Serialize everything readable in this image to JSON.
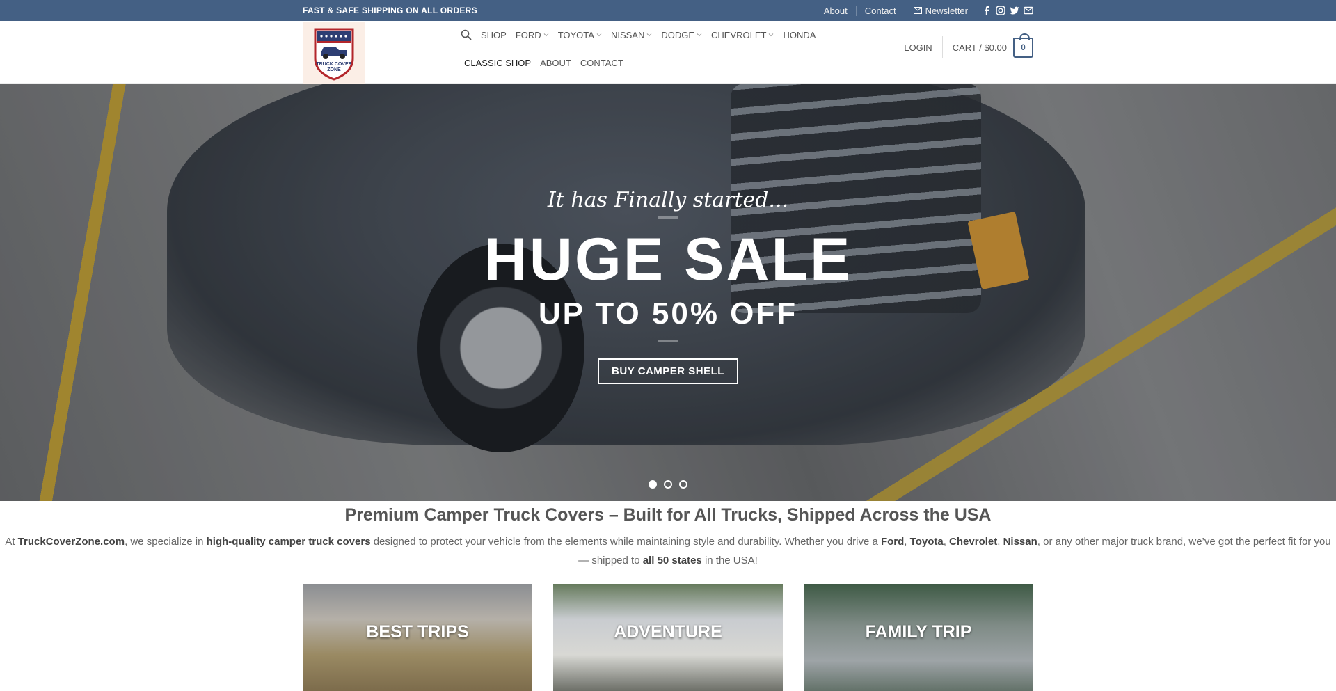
{
  "topbar": {
    "shipping_text": "FAST & SAFE SHIPPING ON ALL ORDERS",
    "links": [
      "About",
      "Contact",
      "Newsletter"
    ],
    "social_icons": [
      "facebook-icon",
      "instagram-icon",
      "twitter-icon",
      "email-icon"
    ]
  },
  "header": {
    "logo_text": "TRUCK COVER ZONE",
    "nav_row1": [
      {
        "label": "SHOP",
        "dropdown": false
      },
      {
        "label": "FORD",
        "dropdown": true
      },
      {
        "label": "TOYOTA",
        "dropdown": true
      },
      {
        "label": "NISSAN",
        "dropdown": true
      },
      {
        "label": "DODGE",
        "dropdown": true
      },
      {
        "label": "CHEVROLET",
        "dropdown": true
      },
      {
        "label": "HONDA",
        "dropdown": false
      }
    ],
    "nav_row2": [
      {
        "label": "CLASSIC SHOP",
        "active": true
      },
      {
        "label": "ABOUT",
        "active": false
      },
      {
        "label": "CONTACT",
        "active": false
      }
    ],
    "login": "LOGIN",
    "cart_label": "CART / $0.00",
    "cart_count": "0"
  },
  "hero": {
    "script": "It has Finally started...",
    "title": "HUGE SALE",
    "subtitle": "UP TO 50% OFF",
    "button": "BUY CAMPER SHELL",
    "slides": 3,
    "active_slide": 1
  },
  "intro": {
    "heading": "Premium Camper Truck Covers – Built for All Trucks, Shipped Across the USA",
    "p_at": "At ",
    "p_site": "TruckCoverZone.com",
    "p_spec": ", we specialize in ",
    "p_quality": "high-quality camper truck covers",
    "p_designed": " designed to protect your vehicle from the elements while maintaining style and durability. Whether you drive a ",
    "b_ford": "Ford",
    "b_toyota": "Toyota",
    "b_chevrolet": "Chevrolet",
    "b_nissan": "Nissan",
    "comma": ", ",
    "p_other": ", or any other major truck brand, we’ve got the perfect fit for you — shipped to ",
    "b_states": "all 50 states",
    "p_end": " in the USA!"
  },
  "cards": [
    {
      "label": "BEST TRIPS"
    },
    {
      "label": "ADVENTURE"
    },
    {
      "label": "FAMILY TRIP"
    }
  ],
  "colors": {
    "topbar_bg": "#446084",
    "accent": "#446084"
  }
}
